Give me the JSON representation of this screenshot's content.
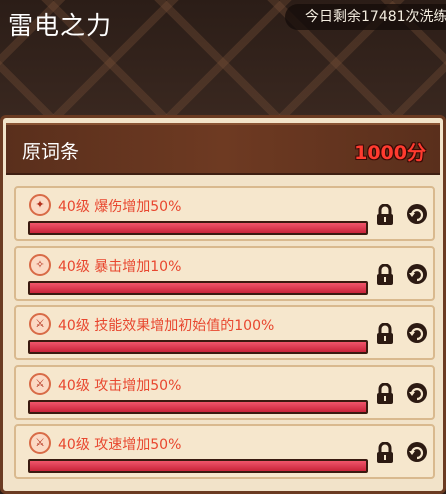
{
  "header": {
    "title": "雷电之力",
    "remaining": "今日剩余17481次洗练"
  },
  "panel": {
    "label": "原词条",
    "points": "1000分"
  },
  "affixes": [
    {
      "text": "40级 爆伤增加50%",
      "icon": "crit-damage-icon",
      "glyph": "✦",
      "fill": 1.0
    },
    {
      "text": "40级 暴击增加10%",
      "icon": "crit-rate-icon",
      "glyph": "✧",
      "fill": 1.0
    },
    {
      "text": "40级 技能效果增加初始值的100%",
      "icon": "sword-icon",
      "glyph": "⚔",
      "fill": 1.0
    },
    {
      "text": "40级 攻击增加50%",
      "icon": "sword-icon",
      "glyph": "⚔",
      "fill": 1.0
    },
    {
      "text": "40级 攻速增加50%",
      "icon": "sword-icon",
      "glyph": "⚔",
      "fill": 1.0
    }
  ],
  "colors": {
    "affix_text": "#e8472f",
    "points": "#ff3b2f",
    "bar_fill": "#d62f45"
  }
}
